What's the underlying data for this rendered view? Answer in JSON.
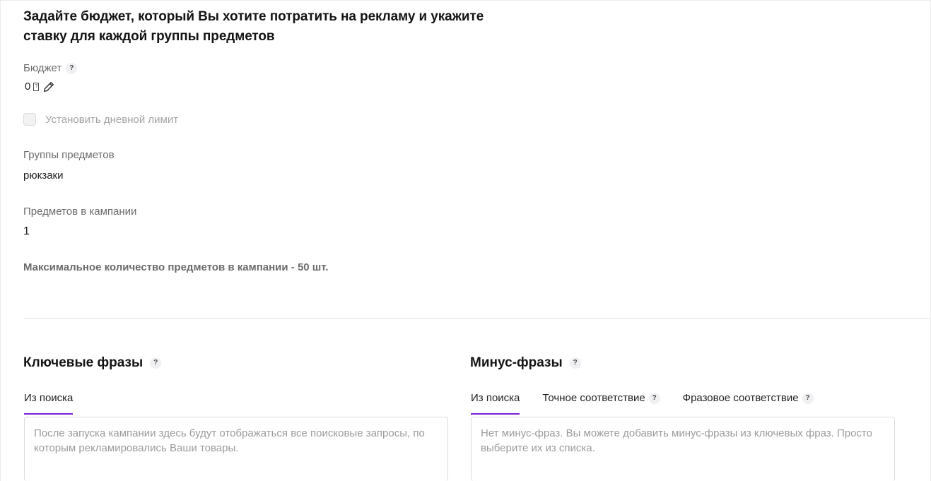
{
  "heading": "Задайте бюджет, который Вы хотите потратить на рекламу и укажите ставку для каждой группы предметов",
  "budget": {
    "label": "Бюджет",
    "help": "?",
    "value": "0",
    "currency_glyph": "?"
  },
  "daily_limit": {
    "label": "Установить дневной лимит",
    "checked": false
  },
  "subject_groups": {
    "label": "Группы предметов",
    "value": "рюкзаки"
  },
  "items_in_campaign": {
    "label": "Предметов в кампании",
    "value": "1"
  },
  "max_items_note": "Максимальное количество предметов в кампании - 50 шт.",
  "keywords": {
    "title": "Ключевые фразы",
    "help": "?",
    "tabs": [
      {
        "label": "Из поиска",
        "active": true
      }
    ],
    "placeholder": "После запуска кампании здесь будут отображаться все поисковые запросы, по которым рекламировались Ваши товары."
  },
  "minus_phrases": {
    "title": "Минус-фразы",
    "help": "?",
    "tabs": [
      {
        "label": "Из поиска",
        "active": true
      },
      {
        "label": "Точное соответствие",
        "help": "?",
        "active": false
      },
      {
        "label": "Фразовое соответствие",
        "help": "?",
        "active": false
      }
    ],
    "placeholder": "Нет минус-фраз. Вы можете добавить минус-фразы из ключевых фраз. Просто выберите их из списка."
  },
  "colors": {
    "accent": "#7b1fd6",
    "text_primary": "#1f1f1f",
    "text_secondary": "#6b6b6b",
    "text_placeholder": "#9b9b9b",
    "border": "#dcdcdc"
  }
}
